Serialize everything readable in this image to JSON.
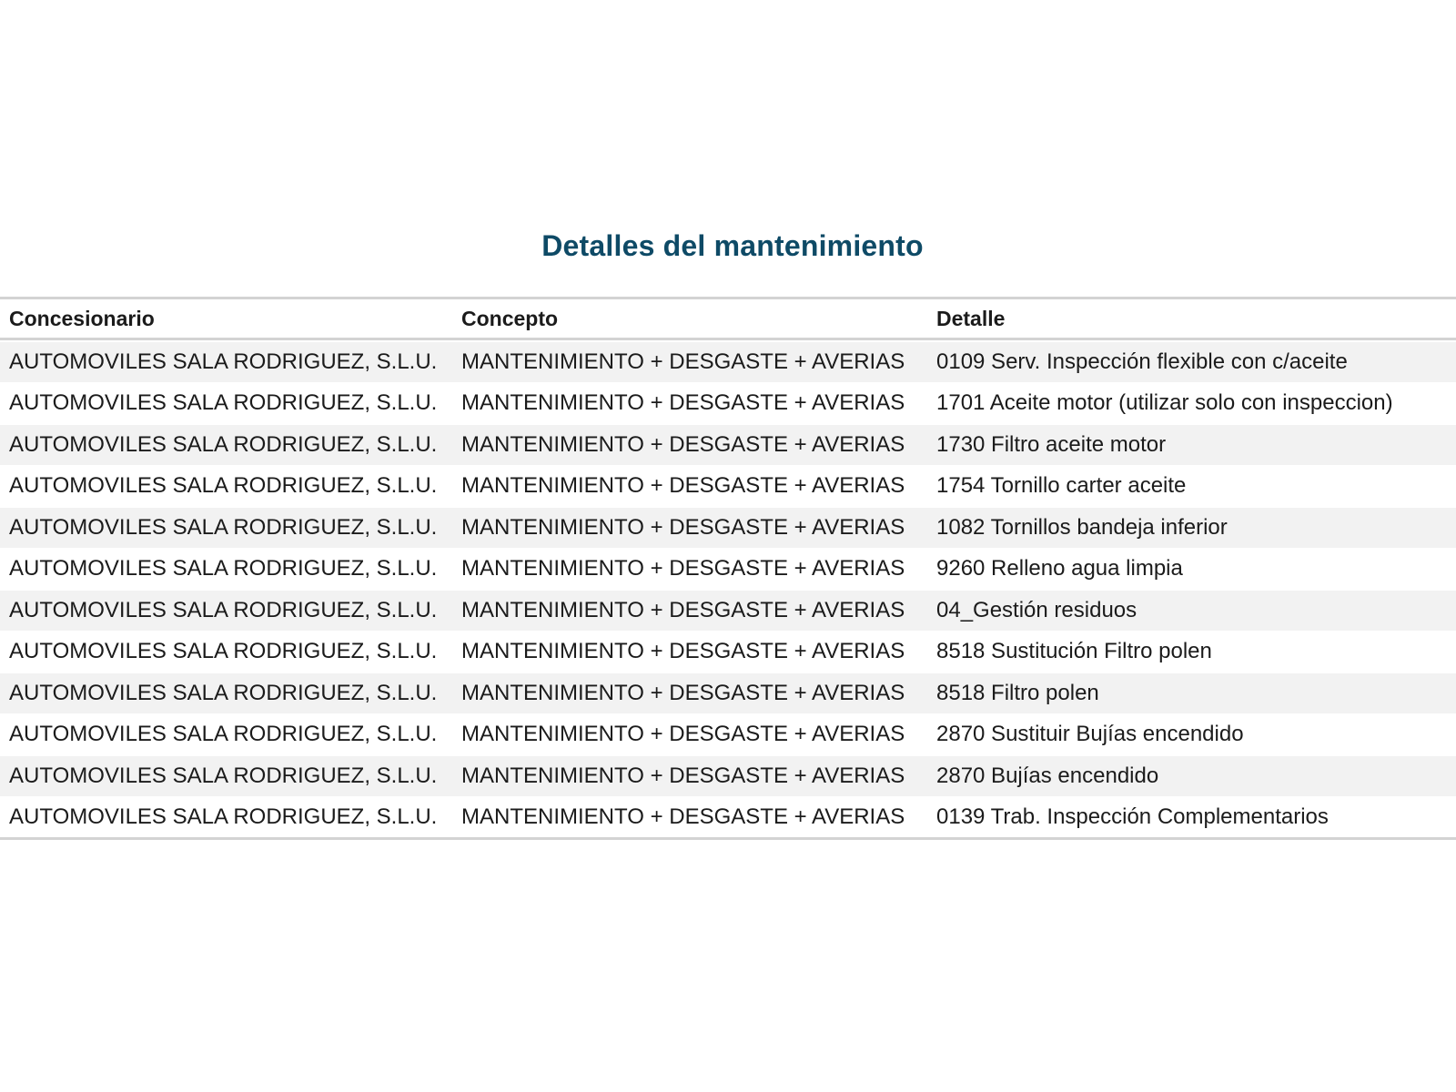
{
  "title": "Detalles del mantenimiento",
  "table": {
    "headers": [
      "Concesionario",
      "Concepto",
      "Detalle"
    ],
    "rows": [
      [
        "AUTOMOVILES SALA RODRIGUEZ, S.L.U.",
        "MANTENIMIENTO + DESGASTE + AVERIAS",
        "0109 Serv. Inspección flexible con c/aceite"
      ],
      [
        "AUTOMOVILES SALA RODRIGUEZ, S.L.U.",
        "MANTENIMIENTO + DESGASTE + AVERIAS",
        "1701 Aceite motor (utilizar solo con inspeccion)"
      ],
      [
        "AUTOMOVILES SALA RODRIGUEZ, S.L.U.",
        "MANTENIMIENTO + DESGASTE + AVERIAS",
        "1730 Filtro aceite motor"
      ],
      [
        "AUTOMOVILES SALA RODRIGUEZ, S.L.U.",
        "MANTENIMIENTO + DESGASTE + AVERIAS",
        "1754 Tornillo carter aceite"
      ],
      [
        "AUTOMOVILES SALA RODRIGUEZ, S.L.U.",
        "MANTENIMIENTO + DESGASTE + AVERIAS",
        "1082 Tornillos bandeja inferior"
      ],
      [
        "AUTOMOVILES SALA RODRIGUEZ, S.L.U.",
        "MANTENIMIENTO + DESGASTE + AVERIAS",
        "9260 Relleno agua limpia"
      ],
      [
        "AUTOMOVILES SALA RODRIGUEZ, S.L.U.",
        "MANTENIMIENTO + DESGASTE + AVERIAS",
        "04_Gestión residuos"
      ],
      [
        "AUTOMOVILES SALA RODRIGUEZ, S.L.U.",
        "MANTENIMIENTO + DESGASTE + AVERIAS",
        "8518 Sustitución Filtro polen"
      ],
      [
        "AUTOMOVILES SALA RODRIGUEZ, S.L.U.",
        "MANTENIMIENTO + DESGASTE + AVERIAS",
        "8518 Filtro polen"
      ],
      [
        "AUTOMOVILES SALA RODRIGUEZ, S.L.U.",
        "MANTENIMIENTO + DESGASTE + AVERIAS",
        "2870 Sustituir Bujías encendido"
      ],
      [
        "AUTOMOVILES SALA RODRIGUEZ, S.L.U.",
        "MANTENIMIENTO + DESGASTE + AVERIAS",
        "2870 Bujías encendido"
      ],
      [
        "AUTOMOVILES SALA RODRIGUEZ, S.L.U.",
        "MANTENIMIENTO + DESGASTE + AVERIAS",
        "0139 Trab. Inspección Complementarios"
      ]
    ]
  }
}
